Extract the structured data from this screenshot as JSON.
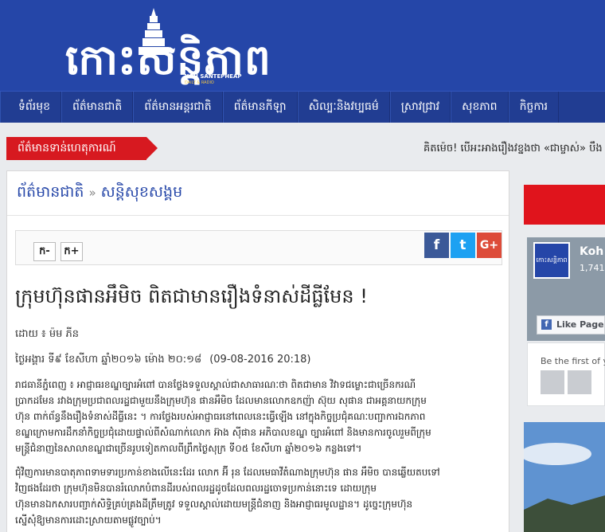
{
  "header": {
    "logo_text": "កោះសន្តិភាព",
    "logo_sub": "KOH SANTEPHEAP",
    "logo_sub2": "DAILY & RADIO"
  },
  "nav": {
    "items": [
      "ទំព័រមុខ",
      "ព័ត៌មានជាតិ",
      "ព័ត៌មានអន្តរជាតិ",
      "ព័ត៌មានកីឡា",
      "សិល្បៈនិងវប្បធម៌",
      "ស្រាវជ្រាវ",
      "សុខភាព",
      "កិច្ចការ"
    ]
  },
  "breaking": {
    "label": "ព័ត៌មានទាន់ហេតុការណ៍",
    "ticker": "គិតម៉េច! បើអះអាងរឿងវខ្នងថា «ជាម្ចាស់» បឹង"
  },
  "breadcrumb": {
    "section": "ព័ត៌មានជាតិ",
    "separator": "»",
    "subsection": "សន្តិសុខសង្គម"
  },
  "toolbar": {
    "font_decrease": "ក-",
    "font_increase": "ក+",
    "share_facebook": "f",
    "share_twitter": "t",
    "share_google": "G+"
  },
  "article": {
    "title": "ក្រុមហ៊ុនផានអឹមិច ពិតជាមានរឿងទំនាស់ដីធ្លីមែន !",
    "byline": "ដោយ ៖ ម៉ម ភីន",
    "date_khmer": "ថ្ងៃអង្គារ ទី៩ ខែសីហា ឆ្នាំ២០១៦ ម៉ោង ២០:១៨",
    "date_latin": "(09-08-2016 20:18)",
    "paragraph1": [
      "រាជធានីភ្នំពេញ ៖ អាជ្ញាធរខណ្ឌច្បារអំពៅ បានថ្លែងទទួលស្គាល់ជាសាធារណៈថា ពិតជាមាន វិវាទជម្លោះជាច្រើនករណី",
      "ប្រាកដមែន រវាងក្រុមប្រជាពលរដ្ឋជាមួយនឹងក្រុមហ៊ុន ផានអឹមិច ដែលមានលោកឧកញ៉ា ស៊ុយ សុផាន ជាអគ្គនាយកក្រុម",
      "ហ៊ុន ពាក់ព័ន្ធនឹងរឿងទំនាស់ដីធ្លីនេះ ។ ការថ្លែងរបស់អាជ្ញាធរនៅពេលនេះធ្វើឡើង នៅក្នុងកិច្ចប្រជុំគណៈបញ្ជាការឯកភាព",
      "ខណ្ឌក្រោមការដឹកនាំកិច្ចប្រជុំដោយផ្ទាល់ពីសំណាក់លោក អ៊ាង ស៊ីផាន អភិបាលខណ្ឌ ច្បារអំពៅ និងមានការចូលរួមពីក្រុម",
      "មន្ត្រីជំនាញនៃសាលាខណ្ឌជាច្រើនរូបទៀតកាលពីព្រឹកថ្ងៃសុក្រ ទី០៥ ខែសីហា ឆ្នាំ២០១៦ កន្លងទៅ។"
    ],
    "paragraph2": [
      "ជុំវិញការមានបាតុភាពទាមទារប្រកាន់ខាងលើនេះដែរ លោក អ៊ី រុន ដែលមេធាវីតំណាងក្រុមហ៊ុន ផាន អឹមិច បានឆ្លើយតបទៅ",
      "វិញផងដែរថា ក្រុមហ៊ុនមិនបានរំលោភបំពានដីរបស់ពលរដ្ឋដូចដែលពលរដ្ឋចោទប្រកាន់នោះទេ ដោយក្រុម",
      "ហ៊ុនមានឯកសារបញ្ជាក់សិទ្ធិគ្រប់គ្រងដីត្រឹមត្រូវ ទទួលស្គាល់ដោយមន្ត្រីជំនាញ និងអាជ្ញាធរមូលដ្ឋាន។ ដូច្នេះក្រុមហ៊ុន",
      "ស្នើសុំឱ្យមានការដោះស្រាយតាមផ្លូវច្បាប់។"
    ]
  },
  "sidebar": {
    "fb_name": "Koh",
    "fb_count": "1,741",
    "fb_avatar_text": "កោះសន្តិភាព",
    "fb_like_label": "Like Page",
    "fb_friends_text": "Be the first of yo"
  },
  "colors": {
    "header_blue": "#2546a8",
    "nav_blue": "#213d92",
    "breaking_red": "#d71920",
    "link_blue": "#2546a8"
  }
}
